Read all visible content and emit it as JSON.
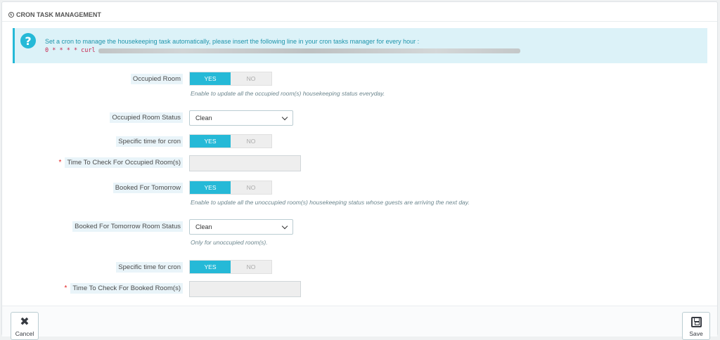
{
  "panel": {
    "title": "CRON TASK MANAGEMENT"
  },
  "alert": {
    "message": "Set a cron to manage the housekeeping task automatically, please insert the following line in your cron tasks manager for every hour :",
    "code": "0 * * * * curl"
  },
  "fields": {
    "occupied_room": {
      "label": "Occupied Room",
      "yes": "YES",
      "no": "NO",
      "value": "YES",
      "help": "Enable to update all the occupied room(s) housekeeping status everyday."
    },
    "occupied_room_status": {
      "label": "Occupied Room Status",
      "value": "Clean"
    },
    "specific_time_1": {
      "label": "Specific time for cron",
      "yes": "YES",
      "no": "NO",
      "value": "YES"
    },
    "time_check_occupied": {
      "label": "Time To Check For Occupied Room(s)",
      "required": "*",
      "value": ""
    },
    "booked_tomorrow": {
      "label": "Booked For Tomorrow",
      "yes": "YES",
      "no": "NO",
      "value": "YES",
      "help": "Enable to update all the unoccupied room(s) housekeeping status whose guests are arriving the next day."
    },
    "booked_tomorrow_status": {
      "label": "Booked For Tomorrow Room Status",
      "value": "Clean",
      "help": "Only for unoccupied room(s)."
    },
    "specific_time_2": {
      "label": "Specific time for cron",
      "yes": "YES",
      "no": "NO",
      "value": "YES"
    },
    "time_check_booked": {
      "label": "Time To Check For Booked Room(s)",
      "required": "*",
      "value": ""
    }
  },
  "footer": {
    "cancel_label": "Cancel",
    "save_label": "Save"
  },
  "colors": {
    "accent": "#25b9d7",
    "alert_bg": "#dcf2f8",
    "required": "#e31b1b"
  },
  "icons": {
    "heading": "clock-icon",
    "alert": "question-icon",
    "cancel": "close-icon",
    "save": "save-icon"
  }
}
